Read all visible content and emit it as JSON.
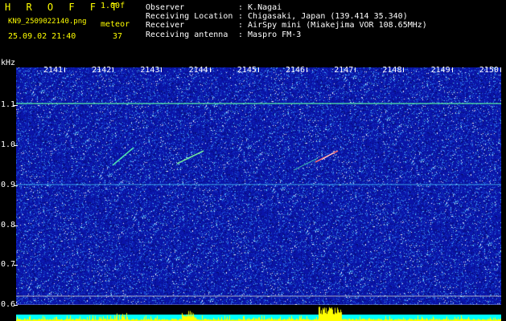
{
  "header": {
    "app_title": "H R O F F T",
    "version": "1.00f",
    "filename": "KN9_2509022140.png",
    "mode": "meteor",
    "datetime": "25.09.02 21:40",
    "count": "37",
    "info": [
      {
        "label": "Observer",
        "value": ": K.Nagai"
      },
      {
        "label": "Receiving Location",
        "value": ": Chigasaki, Japan (139.414 35.340)"
      },
      {
        "label": "Receiver",
        "value": ": AirSpy mini (Miakejima VOR 108.65MHz)"
      },
      {
        "label": "Receiving antenna",
        "value": ": Maspro FM-3"
      }
    ]
  },
  "axes": {
    "y_unit": "kHz",
    "y_ticks": [
      "1.1",
      "1.0",
      "0.9",
      "0.8",
      "0.7",
      "0.6"
    ],
    "x_ticks": [
      "2141",
      "2142",
      "2143",
      "2144",
      "2145",
      "2146",
      "2147",
      "2148",
      "2149",
      "2150"
    ]
  },
  "colors": {
    "background": "#0a14a8",
    "header_text": "#ffff00",
    "info_text": "#ffffff",
    "carrier_line": "#5cffa0",
    "level_bar": "#ffff00",
    "level_base": "#00ffff"
  }
}
